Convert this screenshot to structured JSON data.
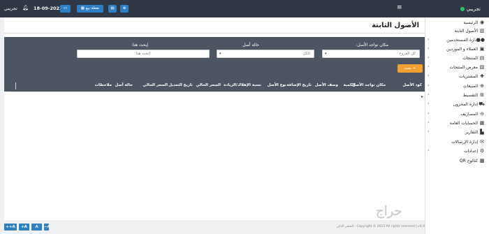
{
  "topbar": {
    "brand": "تجريبي",
    "user": "تجريبي",
    "date": "18-09-2023",
    "pos_button": "نقطة بيع",
    "brand_dot_color": "#27c26a",
    "accent": "#2f7fc4"
  },
  "sidebar": {
    "items": [
      {
        "label": "الرئيسية",
        "icon": "dashboard-icon",
        "glyph": "◉",
        "arrow": false
      },
      {
        "label": "الأصول الثابتة",
        "icon": "assets-icon",
        "glyph": "▥",
        "arrow": false
      },
      {
        "label": "إدارة المستخدمين",
        "icon": "users-icon",
        "glyph": "●●",
        "arrow": true
      },
      {
        "label": "العملاء و الموردين",
        "icon": "contacts-icon",
        "glyph": "▣",
        "arrow": true
      },
      {
        "label": "المنتجات",
        "icon": "products-icon",
        "glyph": "▤",
        "arrow": true
      },
      {
        "label": "معرض المنتجات",
        "icon": "gallery-icon",
        "glyph": "▨",
        "arrow": true
      },
      {
        "label": "المشتريات",
        "icon": "purchases-icon",
        "glyph": "✚",
        "arrow": true
      },
      {
        "label": "المبيعات",
        "icon": "sales-icon",
        "glyph": "⊕",
        "arrow": true
      },
      {
        "label": "التقسيط",
        "icon": "installments-icon",
        "glyph": "⊞",
        "arrow": true
      },
      {
        "label": "إدارة المخزون",
        "icon": "inventory-icon",
        "glyph": "⛟",
        "arrow": true
      },
      {
        "label": "المصاريف",
        "icon": "expenses-icon",
        "glyph": "⊖",
        "arrow": true
      },
      {
        "label": "الحسابات العامة",
        "icon": "accounts-icon",
        "glyph": "▦",
        "arrow": true
      },
      {
        "label": "التقارير",
        "icon": "reports-icon",
        "glyph": "▙",
        "arrow": true
      },
      {
        "label": "إدارة الإرسالات",
        "icon": "messages-icon",
        "glyph": "✉",
        "arrow": false
      },
      {
        "label": "إعدادات",
        "icon": "settings-icon",
        "glyph": "⚙",
        "arrow": true
      },
      {
        "label": "كتالوج QR",
        "icon": "qr-icon",
        "glyph": "▩",
        "arrow": false
      }
    ]
  },
  "main": {
    "title": "الأصول الثابتة",
    "filters": {
      "location_label": "مكان تواجد الأصل:",
      "location_value": "كل الفروع",
      "status_label": "حالة أصل",
      "status_value": "الكل",
      "search_label": "إبحث هنا:",
      "search_placeholder": "إبحث هنا"
    },
    "search_button": "+ بحث",
    "columns": [
      "كود الأصل",
      "مكان تواجد الأصل",
      "الكمية",
      "وصف الأصل",
      "تاريخ الإضافة",
      "نوع الأصل",
      "نسبة الإهلاك/الزيادة",
      "السعر الحالي",
      "تاريخ التعديل",
      "السعر الحالي",
      "حالة أصل",
      "ملاحظات"
    ]
  },
  "footer": {
    "zoom_buttons": [
      "++A",
      "+A",
      "A",
      "−A"
    ],
    "copyright": "المتجر الذكي - Copyright © 2023 All rights reserved | v4.0"
  }
}
